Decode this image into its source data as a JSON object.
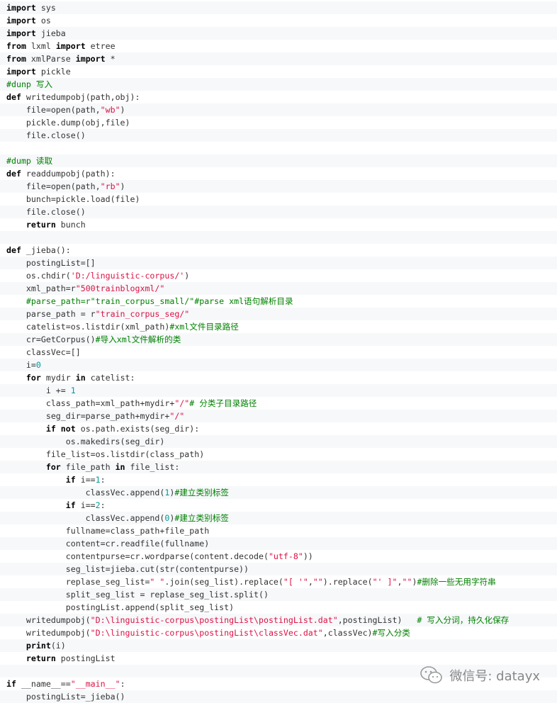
{
  "code_lines": [
    [
      {
        "t": "import",
        "c": "kw"
      },
      {
        "t": " sys"
      }
    ],
    [
      {
        "t": "import",
        "c": "kw"
      },
      {
        "t": " os"
      }
    ],
    [
      {
        "t": "import",
        "c": "kw"
      },
      {
        "t": " jieba"
      }
    ],
    [
      {
        "t": "from",
        "c": "kw"
      },
      {
        "t": " lxml "
      },
      {
        "t": "import",
        "c": "kw"
      },
      {
        "t": " etree"
      }
    ],
    [
      {
        "t": "from",
        "c": "kw"
      },
      {
        "t": " xmlParse "
      },
      {
        "t": "import",
        "c": "kw"
      },
      {
        "t": " *"
      }
    ],
    [
      {
        "t": "import",
        "c": "kw"
      },
      {
        "t": " pickle"
      }
    ],
    [
      {
        "t": "#dunp 写入",
        "c": "cm green"
      }
    ],
    [
      {
        "t": "def",
        "c": "kw"
      },
      {
        "t": " writedumpobj(path,obj):"
      }
    ],
    [
      {
        "t": "    file=open(path,"
      },
      {
        "t": "\"wb\"",
        "c": "str"
      },
      {
        "t": ")"
      }
    ],
    [
      {
        "t": "    pickle.dump(obj,file)"
      }
    ],
    [
      {
        "t": "    file.close()"
      }
    ],
    [],
    [
      {
        "t": "#dump 读取",
        "c": "cm green"
      }
    ],
    [
      {
        "t": "def",
        "c": "kw"
      },
      {
        "t": " readdumpobj(path):"
      }
    ],
    [
      {
        "t": "    file=open(path,"
      },
      {
        "t": "\"rb\"",
        "c": "str"
      },
      {
        "t": ")"
      }
    ],
    [
      {
        "t": "    bunch=pickle.load(file)"
      }
    ],
    [
      {
        "t": "    file.close()"
      }
    ],
    [
      {
        "t": "    "
      },
      {
        "t": "return",
        "c": "kw"
      },
      {
        "t": " bunch"
      }
    ],
    [],
    [
      {
        "t": "def",
        "c": "kw"
      },
      {
        "t": " _jieba():"
      }
    ],
    [
      {
        "t": "    postingList=[]"
      }
    ],
    [
      {
        "t": "    os.chdir("
      },
      {
        "t": "'D:/linguistic-corpus/'",
        "c": "str"
      },
      {
        "t": ")"
      }
    ],
    [
      {
        "t": "    xml_path=r"
      },
      {
        "t": "\"500trainblogxml/\"",
        "c": "str"
      }
    ],
    [
      {
        "t": "    "
      },
      {
        "t": "#parse_path=r\"train_corpus_small/\"#parse xml语句解析目录",
        "c": "cm green"
      }
    ],
    [
      {
        "t": "    parse_path = r"
      },
      {
        "t": "\"train_corpus_seg/\"",
        "c": "str"
      }
    ],
    [
      {
        "t": "    catelist=os.listdir(xml_path)"
      },
      {
        "t": "#xml文件目录路径",
        "c": "cm green"
      }
    ],
    [
      {
        "t": "    cr=GetCorpus()"
      },
      {
        "t": "#导入xml文件解析的类",
        "c": "cm green"
      }
    ],
    [
      {
        "t": "    classVec=[]"
      }
    ],
    [
      {
        "t": "    i="
      },
      {
        "t": "0",
        "c": "num"
      }
    ],
    [
      {
        "t": "    "
      },
      {
        "t": "for",
        "c": "kw"
      },
      {
        "t": " mydir "
      },
      {
        "t": "in",
        "c": "kw"
      },
      {
        "t": " catelist:"
      }
    ],
    [
      {
        "t": "        i += "
      },
      {
        "t": "1",
        "c": "num"
      }
    ],
    [
      {
        "t": "        class_path=xml_path+mydir+"
      },
      {
        "t": "\"/\"",
        "c": "str"
      },
      {
        "t": "# 分类子目录路径",
        "c": "cm green"
      }
    ],
    [
      {
        "t": "        seg_dir=parse_path+mydir+"
      },
      {
        "t": "\"/\"",
        "c": "str"
      }
    ],
    [
      {
        "t": "        "
      },
      {
        "t": "if",
        "c": "kw"
      },
      {
        "t": " "
      },
      {
        "t": "not",
        "c": "kw"
      },
      {
        "t": " os.path.exists(seg_dir):"
      }
    ],
    [
      {
        "t": "            os.makedirs(seg_dir)"
      }
    ],
    [
      {
        "t": "        file_list=os.listdir(class_path)"
      }
    ],
    [
      {
        "t": "        "
      },
      {
        "t": "for",
        "c": "kw"
      },
      {
        "t": " file_path "
      },
      {
        "t": "in",
        "c": "kw"
      },
      {
        "t": " file_list:"
      }
    ],
    [
      {
        "t": "            "
      },
      {
        "t": "if",
        "c": "kw"
      },
      {
        "t": " i=="
      },
      {
        "t": "1",
        "c": "num"
      },
      {
        "t": ":"
      }
    ],
    [
      {
        "t": "                classVec.append("
      },
      {
        "t": "1",
        "c": "num"
      },
      {
        "t": ")"
      },
      {
        "t": "#建立类别标签",
        "c": "cm green"
      }
    ],
    [
      {
        "t": "            "
      },
      {
        "t": "if",
        "c": "kw"
      },
      {
        "t": " i=="
      },
      {
        "t": "2",
        "c": "num"
      },
      {
        "t": ":"
      }
    ],
    [
      {
        "t": "                classVec.append("
      },
      {
        "t": "0",
        "c": "num"
      },
      {
        "t": ")"
      },
      {
        "t": "#建立类别标签",
        "c": "cm green"
      }
    ],
    [
      {
        "t": "            fullname=class_path+file_path"
      }
    ],
    [
      {
        "t": "            content=cr.readfile(fullname)"
      }
    ],
    [
      {
        "t": "            contentpurse=cr.wordparse(content.decode("
      },
      {
        "t": "\"utf-8\"",
        "c": "str"
      },
      {
        "t": "))"
      }
    ],
    [
      {
        "t": "            seg_list=jieba.cut(str(contentpurse))"
      }
    ],
    [
      {
        "t": "            replase_seg_list="
      },
      {
        "t": "\" \"",
        "c": "str"
      },
      {
        "t": ".join(seg_list).replace("
      },
      {
        "t": "\"[ '\"",
        "c": "str"
      },
      {
        "t": ","
      },
      {
        "t": "\"\"",
        "c": "str"
      },
      {
        "t": ").replace("
      },
      {
        "t": "\"' ]\"",
        "c": "str"
      },
      {
        "t": ","
      },
      {
        "t": "\"\"",
        "c": "str"
      },
      {
        "t": ")"
      },
      {
        "t": "#删除一些无用字符串",
        "c": "cm green"
      }
    ],
    [
      {
        "t": "            split_seg_list = replase_seg_list.split()"
      }
    ],
    [
      {
        "t": "            postingList.append(split_seg_list)"
      }
    ],
    [
      {
        "t": "    writedumpobj("
      },
      {
        "t": "\"D:\\linguistic-corpus\\postingList\\postingList.dat\"",
        "c": "str"
      },
      {
        "t": ",postingList)   "
      },
      {
        "t": "# 写入分词，持久化保存",
        "c": "cm green"
      }
    ],
    [
      {
        "t": "    writedumpobj("
      },
      {
        "t": "\"D:\\linguistic-corpus\\postingList\\classVec.dat\"",
        "c": "str"
      },
      {
        "t": ",classVec)"
      },
      {
        "t": "#写入分类",
        "c": "cm green"
      }
    ],
    [
      {
        "t": "    "
      },
      {
        "t": "print",
        "c": "kw"
      },
      {
        "t": "(i)"
      }
    ],
    [
      {
        "t": "    "
      },
      {
        "t": "return",
        "c": "kw"
      },
      {
        "t": " postingList"
      }
    ],
    [],
    [
      {
        "t": "if",
        "c": "kw"
      },
      {
        "t": " __name__=="
      },
      {
        "t": "\"__main__\"",
        "c": "str"
      },
      {
        "t": ":"
      }
    ],
    [
      {
        "t": "    postingList=_jieba()"
      }
    ]
  ],
  "watermark": {
    "icon": "wechat-icon",
    "text": "微信号: datayx"
  }
}
